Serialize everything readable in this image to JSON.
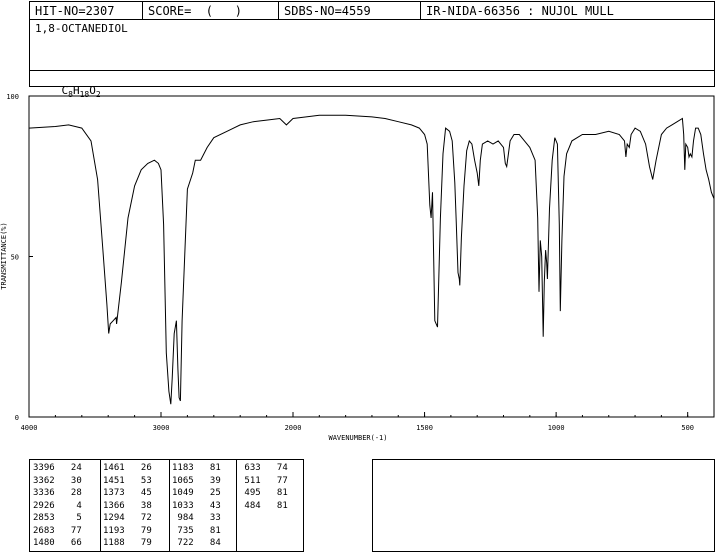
{
  "header": {
    "hit_no": "HIT-NO=2307",
    "score": "SCORE=  (   )",
    "sdbs_no": "SDBS-NO=4559",
    "method": "IR-NIDA-66356 : NUJOL MULL"
  },
  "compound": {
    "name": "1,8-OCTANEDIOL",
    "formula_main": [
      "C",
      "H",
      "O"
    ],
    "formula_sub": [
      "8",
      "18",
      "2"
    ]
  },
  "chart_data": {
    "type": "line",
    "title": "",
    "xlabel": "WAVENUMBER(-1)",
    "ylabel": "TRANSMITTANCE(%)",
    "xlim": [
      4000,
      400
    ],
    "ylim": [
      0,
      100
    ],
    "x_ticks": [
      4000,
      3000,
      2000,
      1500,
      1000,
      500
    ],
    "y_ticks": [
      0,
      50,
      100
    ],
    "series": [
      {
        "points": [
          [
            4000,
            90
          ],
          [
            3800,
            90.5
          ],
          [
            3700,
            91
          ],
          [
            3600,
            90
          ],
          [
            3530,
            86
          ],
          [
            3480,
            74
          ],
          [
            3440,
            52
          ],
          [
            3410,
            35
          ],
          [
            3396,
            26
          ],
          [
            3385,
            29
          ],
          [
            3362,
            30
          ],
          [
            3340,
            31
          ],
          [
            3336,
            29
          ],
          [
            3300,
            42
          ],
          [
            3250,
            62
          ],
          [
            3200,
            72
          ],
          [
            3150,
            77
          ],
          [
            3100,
            79
          ],
          [
            3050,
            80
          ],
          [
            3020,
            79
          ],
          [
            3000,
            77
          ],
          [
            2980,
            60
          ],
          [
            2960,
            20
          ],
          [
            2940,
            8
          ],
          [
            2926,
            4
          ],
          [
            2915,
            12
          ],
          [
            2900,
            26
          ],
          [
            2883,
            30
          ],
          [
            2872,
            15
          ],
          [
            2863,
            6
          ],
          [
            2853,
            5
          ],
          [
            2840,
            30
          ],
          [
            2800,
            71
          ],
          [
            2760,
            76
          ],
          [
            2740,
            80
          ],
          [
            2700,
            80
          ],
          [
            2650,
            84
          ],
          [
            2600,
            87
          ],
          [
            2500,
            89
          ],
          [
            2400,
            91
          ],
          [
            2300,
            92
          ],
          [
            2200,
            92.5
          ],
          [
            2100,
            93
          ],
          [
            2050,
            91
          ],
          [
            2000,
            93
          ],
          [
            1950,
            93.5
          ],
          [
            1900,
            94
          ],
          [
            1800,
            94
          ],
          [
            1700,
            93.5
          ],
          [
            1650,
            93
          ],
          [
            1600,
            92
          ],
          [
            1550,
            91
          ],
          [
            1520,
            90
          ],
          [
            1500,
            88
          ],
          [
            1490,
            85
          ],
          [
            1480,
            66
          ],
          [
            1475,
            62
          ],
          [
            1470,
            70
          ],
          [
            1461,
            30
          ],
          [
            1451,
            28
          ],
          [
            1440,
            62
          ],
          [
            1430,
            82
          ],
          [
            1420,
            90
          ],
          [
            1405,
            89
          ],
          [
            1395,
            86
          ],
          [
            1385,
            73
          ],
          [
            1380,
            62
          ],
          [
            1373,
            45
          ],
          [
            1368,
            43
          ],
          [
            1366,
            41
          ],
          [
            1360,
            56
          ],
          [
            1350,
            72
          ],
          [
            1340,
            83
          ],
          [
            1330,
            86
          ],
          [
            1320,
            85
          ],
          [
            1310,
            80
          ],
          [
            1300,
            76
          ],
          [
            1294,
            72
          ],
          [
            1288,
            80
          ],
          [
            1280,
            85
          ],
          [
            1260,
            86
          ],
          [
            1240,
            85
          ],
          [
            1220,
            86
          ],
          [
            1200,
            84
          ],
          [
            1193,
            79
          ],
          [
            1188,
            78
          ],
          [
            1183,
            81
          ],
          [
            1175,
            86
          ],
          [
            1160,
            88
          ],
          [
            1140,
            88
          ],
          [
            1120,
            86
          ],
          [
            1100,
            84
          ],
          [
            1080,
            80
          ],
          [
            1070,
            62
          ],
          [
            1065,
            39
          ],
          [
            1060,
            55
          ],
          [
            1055,
            50
          ],
          [
            1049,
            25
          ],
          [
            1045,
            42
          ],
          [
            1040,
            52
          ],
          [
            1036,
            48
          ],
          [
            1033,
            43
          ],
          [
            1025,
            65
          ],
          [
            1015,
            80
          ],
          [
            1005,
            87
          ],
          [
            995,
            85
          ],
          [
            988,
            60
          ],
          [
            984,
            33
          ],
          [
            978,
            55
          ],
          [
            970,
            75
          ],
          [
            960,
            82
          ],
          [
            940,
            86
          ],
          [
            900,
            88
          ],
          [
            850,
            88
          ],
          [
            800,
            89
          ],
          [
            760,
            88
          ],
          [
            740,
            86
          ],
          [
            735,
            81
          ],
          [
            730,
            85
          ],
          [
            722,
            84
          ],
          [
            715,
            88
          ],
          [
            700,
            90
          ],
          [
            680,
            89
          ],
          [
            660,
            85
          ],
          [
            645,
            78
          ],
          [
            633,
            74
          ],
          [
            620,
            80
          ],
          [
            600,
            88
          ],
          [
            580,
            90
          ],
          [
            560,
            91
          ],
          [
            540,
            92
          ],
          [
            520,
            93
          ],
          [
            515,
            88
          ],
          [
            511,
            77
          ],
          [
            507,
            85
          ],
          [
            500,
            84
          ],
          [
            495,
            81
          ],
          [
            490,
            82
          ],
          [
            484,
            81
          ],
          [
            478,
            86
          ],
          [
            470,
            90
          ],
          [
            460,
            90
          ],
          [
            450,
            88
          ],
          [
            440,
            82
          ],
          [
            430,
            77
          ],
          [
            420,
            74
          ],
          [
            410,
            70
          ],
          [
            400,
            68
          ]
        ]
      }
    ]
  },
  "peak_table": {
    "columns": [
      [
        [
          "3396",
          "24"
        ],
        [
          "3362",
          "30"
        ],
        [
          "3336",
          "28"
        ],
        [
          "2926",
          "4"
        ],
        [
          "2853",
          "5"
        ],
        [
          "2683",
          "77"
        ],
        [
          "1480",
          "66"
        ]
      ],
      [
        [
          "1461",
          "26"
        ],
        [
          "1451",
          "53"
        ],
        [
          "1373",
          "45"
        ],
        [
          "1366",
          "38"
        ],
        [
          "1294",
          "72"
        ],
        [
          "1193",
          "79"
        ],
        [
          "1188",
          "79"
        ]
      ],
      [
        [
          "1183",
          "81"
        ],
        [
          "1065",
          "39"
        ],
        [
          "1049",
          "25"
        ],
        [
          "1033",
          "43"
        ],
        [
          "984",
          "33"
        ],
        [
          "735",
          "81"
        ],
        [
          "722",
          "84"
        ]
      ],
      [
        [
          "633",
          "74"
        ],
        [
          "511",
          "77"
        ],
        [
          "495",
          "81"
        ],
        [
          "484",
          "81"
        ]
      ]
    ]
  }
}
